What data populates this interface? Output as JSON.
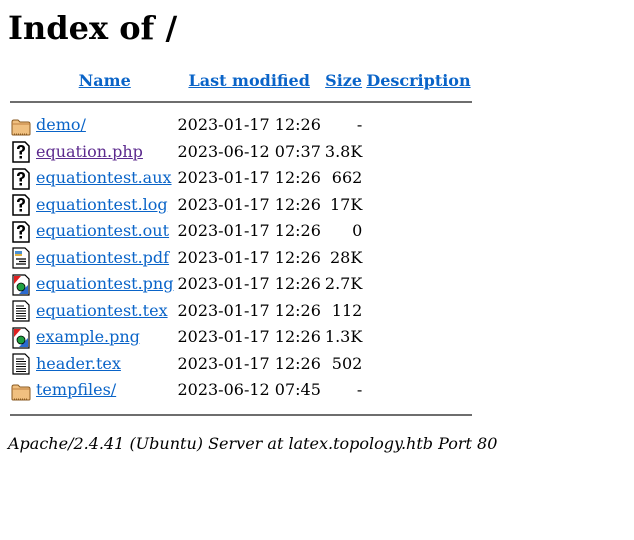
{
  "page": {
    "title": "Index of /"
  },
  "table": {
    "headers": {
      "name": "Name",
      "last_modified": "Last modified",
      "size": "Size",
      "description": "Description"
    },
    "rows": [
      {
        "icon": "folder-icon",
        "name": "demo/",
        "modified": "2023-01-17 12:26",
        "size": "-",
        "description": "",
        "visited": false
      },
      {
        "icon": "unknown-file-icon",
        "name": "equation.php",
        "modified": "2023-06-12 07:37",
        "size": "3.8K",
        "description": "",
        "visited": true
      },
      {
        "icon": "unknown-file-icon",
        "name": "equationtest.aux",
        "modified": "2023-01-17 12:26",
        "size": "662",
        "description": "",
        "visited": false
      },
      {
        "icon": "unknown-file-icon",
        "name": "equationtest.log",
        "modified": "2023-01-17 12:26",
        "size": "17K",
        "description": "",
        "visited": false
      },
      {
        "icon": "unknown-file-icon",
        "name": "equationtest.out",
        "modified": "2023-01-17 12:26",
        "size": "0",
        "description": "",
        "visited": false
      },
      {
        "icon": "layout-file-icon",
        "name": "equationtest.pdf",
        "modified": "2023-01-17 12:26",
        "size": "28K",
        "description": "",
        "visited": false
      },
      {
        "icon": "image-file-icon",
        "name": "equationtest.png",
        "modified": "2023-01-17 12:26",
        "size": "2.7K",
        "description": "",
        "visited": false
      },
      {
        "icon": "text-file-icon",
        "name": "equationtest.tex",
        "modified": "2023-01-17 12:26",
        "size": "112",
        "description": "",
        "visited": false
      },
      {
        "icon": "image-file-icon",
        "name": "example.png",
        "modified": "2023-01-17 12:26",
        "size": "1.3K",
        "description": "",
        "visited": false
      },
      {
        "icon": "text-file-icon",
        "name": "header.tex",
        "modified": "2023-01-17 12:26",
        "size": "502",
        "description": "",
        "visited": false
      },
      {
        "icon": "folder-icon",
        "name": "tempfiles/",
        "modified": "2023-06-12 07:45",
        "size": "-",
        "description": "",
        "visited": false
      }
    ]
  },
  "footer": {
    "server_signature": "Apache/2.4.41 (Ubuntu) Server at latex.topology.htb Port 80"
  },
  "colors": {
    "link": "#0a64c8",
    "visited_link": "#5c2a8e",
    "rule": "#6e6e6e"
  }
}
